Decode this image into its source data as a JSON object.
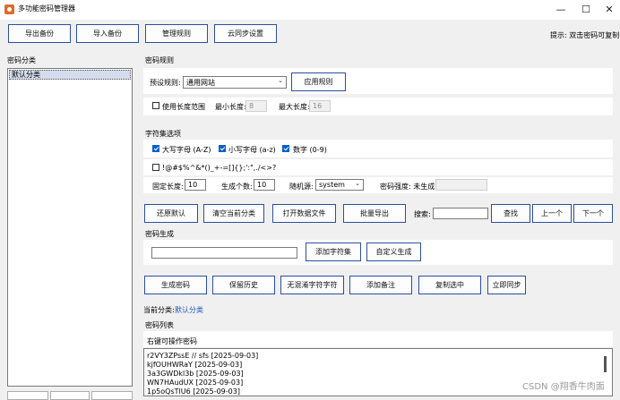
{
  "window": {
    "title": "多功能密码管理器",
    "minimize": "—",
    "maximize": "☐",
    "close": "✕"
  },
  "toolbar": {
    "export_label": "导出备份",
    "import_label": "导入备份",
    "rules_label": "管理规则",
    "cloud_label": "云同步设置",
    "hint": "提示: 双击密码可复制"
  },
  "category": {
    "heading": "密码分类",
    "items": [
      "默认分类"
    ]
  },
  "rules": {
    "heading": "密码规则",
    "preset_label": "预设规则:",
    "preset_value": "通用网站",
    "apply_label": "应用规则",
    "use_range_label": "使用长度范围",
    "min_label": "最小长度:",
    "min_value": "8",
    "max_label": "最大长度:",
    "max_value": "16"
  },
  "charset": {
    "heading": "字符集选项",
    "upper_label": "大写字母 (A-Z)",
    "lower_label": "小写字母 (a-z)",
    "digit_label": "数字 (0-9)",
    "symbols_label": "!@#$%^&*()_+-=[]{};':\",./<>?",
    "fixed_len_label": "固定长度:",
    "fixed_len_value": "10",
    "count_label": "生成个数:",
    "count_value": "10",
    "random_label": "随机源:",
    "random_value": "system",
    "strength_label": "密码强度: 未生成"
  },
  "actions1": {
    "restore_label": "还原默认",
    "clear_label": "清空当前分类",
    "open_label": "打开数据文件",
    "batch_export_label": "批量导出",
    "search_label": "搜索:",
    "search_value": "",
    "find_label": "查找",
    "prev_label": "上一个",
    "next_label": "下一个"
  },
  "generate": {
    "heading": "密码生成",
    "input_value": "",
    "add_charset_label": "添加字符集",
    "custom_label": "自定义生成"
  },
  "actions2": {
    "gen_label": "生成密码",
    "history_label": "保留历史",
    "nochar_label": "无混淆字符字符",
    "note_label": "添加备注",
    "copy_label": "复制选中",
    "sync_label": "立即同步"
  },
  "current": {
    "label": "当前分类:",
    "value": "默认分类"
  },
  "list": {
    "heading": "密码列表",
    "hint": "右键可操作密码",
    "rows": [
      "r2VY3ZPssE  // sfs  [2025-09-03]",
      "kjfOUHWRaY  [2025-09-03]",
      "3a3GWDkl3b  [2025-09-03]",
      "WN7HAudUX  [2025-09-03]",
      "1p5oQsTlU6  [2025-09-03]"
    ]
  },
  "watermark": "CSDN @翔香牛肉面"
}
